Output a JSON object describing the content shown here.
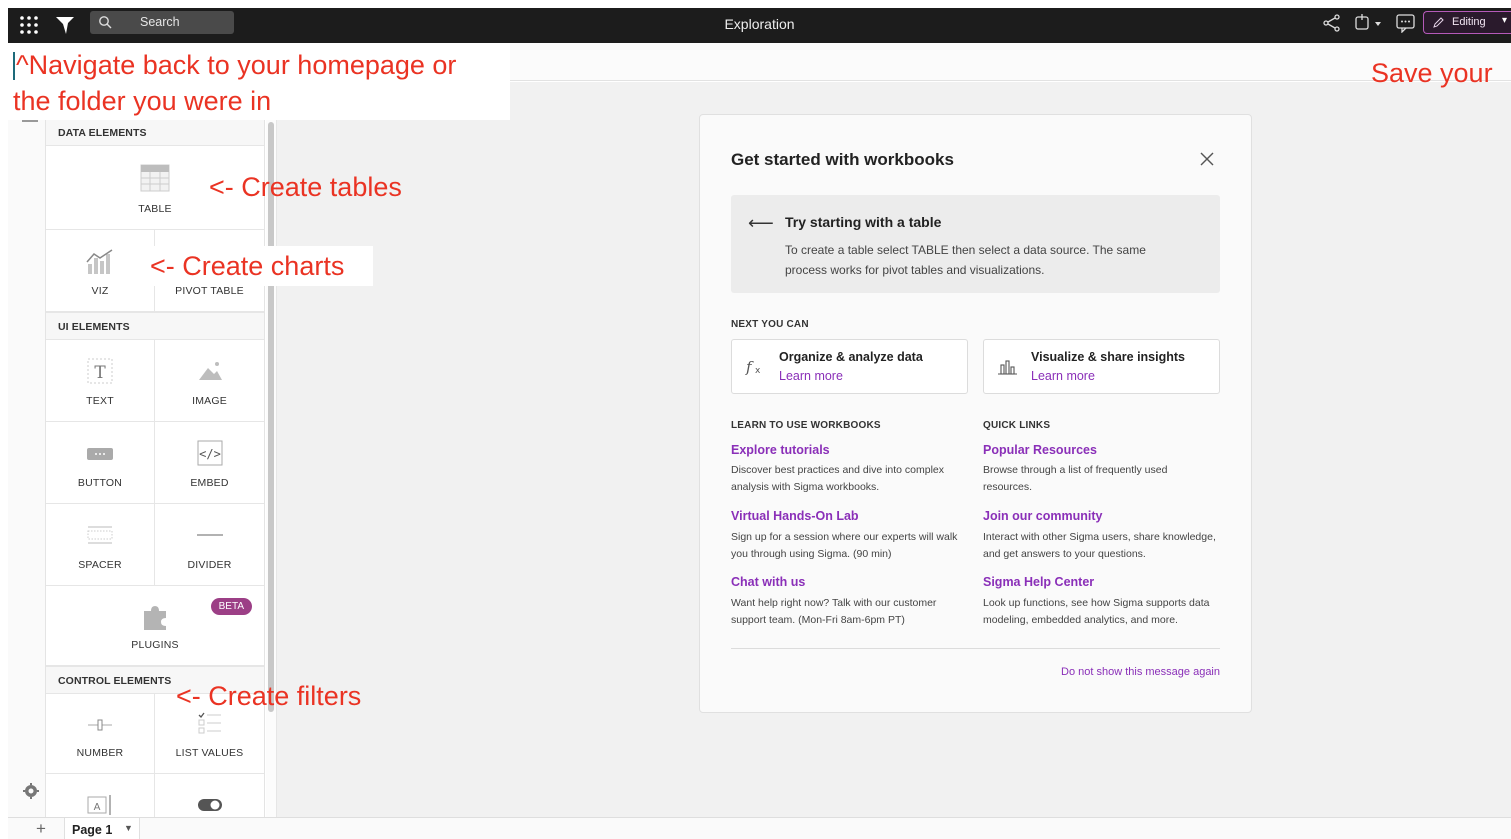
{
  "topbar": {
    "search_placeholder": "Search",
    "title": "Exploration",
    "editing_label": "Editing"
  },
  "panel": {
    "sections": {
      "data": "DATA ELEMENTS",
      "ui": "UI ELEMENTS",
      "control": "CONTROL ELEMENTS"
    },
    "items": {
      "table": "TABLE",
      "viz": "VIZ",
      "pivot": "PIVOT TABLE",
      "text": "TEXT",
      "image": "IMAGE",
      "button": "BUTTON",
      "embed": "EMBED",
      "spacer": "SPACER",
      "divider": "DIVIDER",
      "plugins": "PLUGINS",
      "number": "NUMBER",
      "list_values": "LIST VALUES"
    },
    "beta_badge": "BETA"
  },
  "annotations": {
    "navigate_line1": "^Navigate back to your homepage or",
    "navigate_line2": "the folder you were in",
    "save": "Save your",
    "tables": "<- Create tables",
    "charts": "<- Create charts",
    "filters": "<- Create filters"
  },
  "card": {
    "title": "Get started with workbooks",
    "hint_title": "Try starting with a table",
    "hint_body": "To create a table select TABLE then select a data source. The same process works for pivot tables and visualizations.",
    "next_heading": "NEXT YOU CAN",
    "next_cards": [
      {
        "title": "Organize & analyze data",
        "link": "Learn more"
      },
      {
        "title": "Visualize & share insights",
        "link": "Learn more"
      }
    ],
    "learn_heading": "LEARN TO USE WORKBOOKS",
    "quick_heading": "QUICK LINKS",
    "learn_links": [
      {
        "title": "Explore tutorials",
        "desc": "Discover best practices and dive into complex analysis with Sigma workbooks."
      },
      {
        "title": "Virtual Hands-On Lab",
        "desc": "Sign up for a session where our experts will walk you through using Sigma. (90 min)"
      },
      {
        "title": "Chat with us",
        "desc": "Want help right now? Talk with our customer support team. (Mon-Fri 8am-6pm PT)"
      }
    ],
    "quick_links": [
      {
        "title": "Popular Resources",
        "desc": "Browse through a list of frequently used resources."
      },
      {
        "title": "Join our community",
        "desc": "Interact with other Sigma users, share knowledge, and get answers to your questions."
      },
      {
        "title": "Sigma Help Center",
        "desc": "Look up functions, see how Sigma supports data modeling, embedded analytics, and more."
      }
    ],
    "footer_link": "Do not show this message again"
  },
  "pagebar": {
    "page_tab": "Page 1"
  },
  "colors": {
    "accent": "#8a2fb8",
    "annotation": "#ea3323",
    "beta": "#9c3f86",
    "topbar": "#1c1c1c"
  }
}
